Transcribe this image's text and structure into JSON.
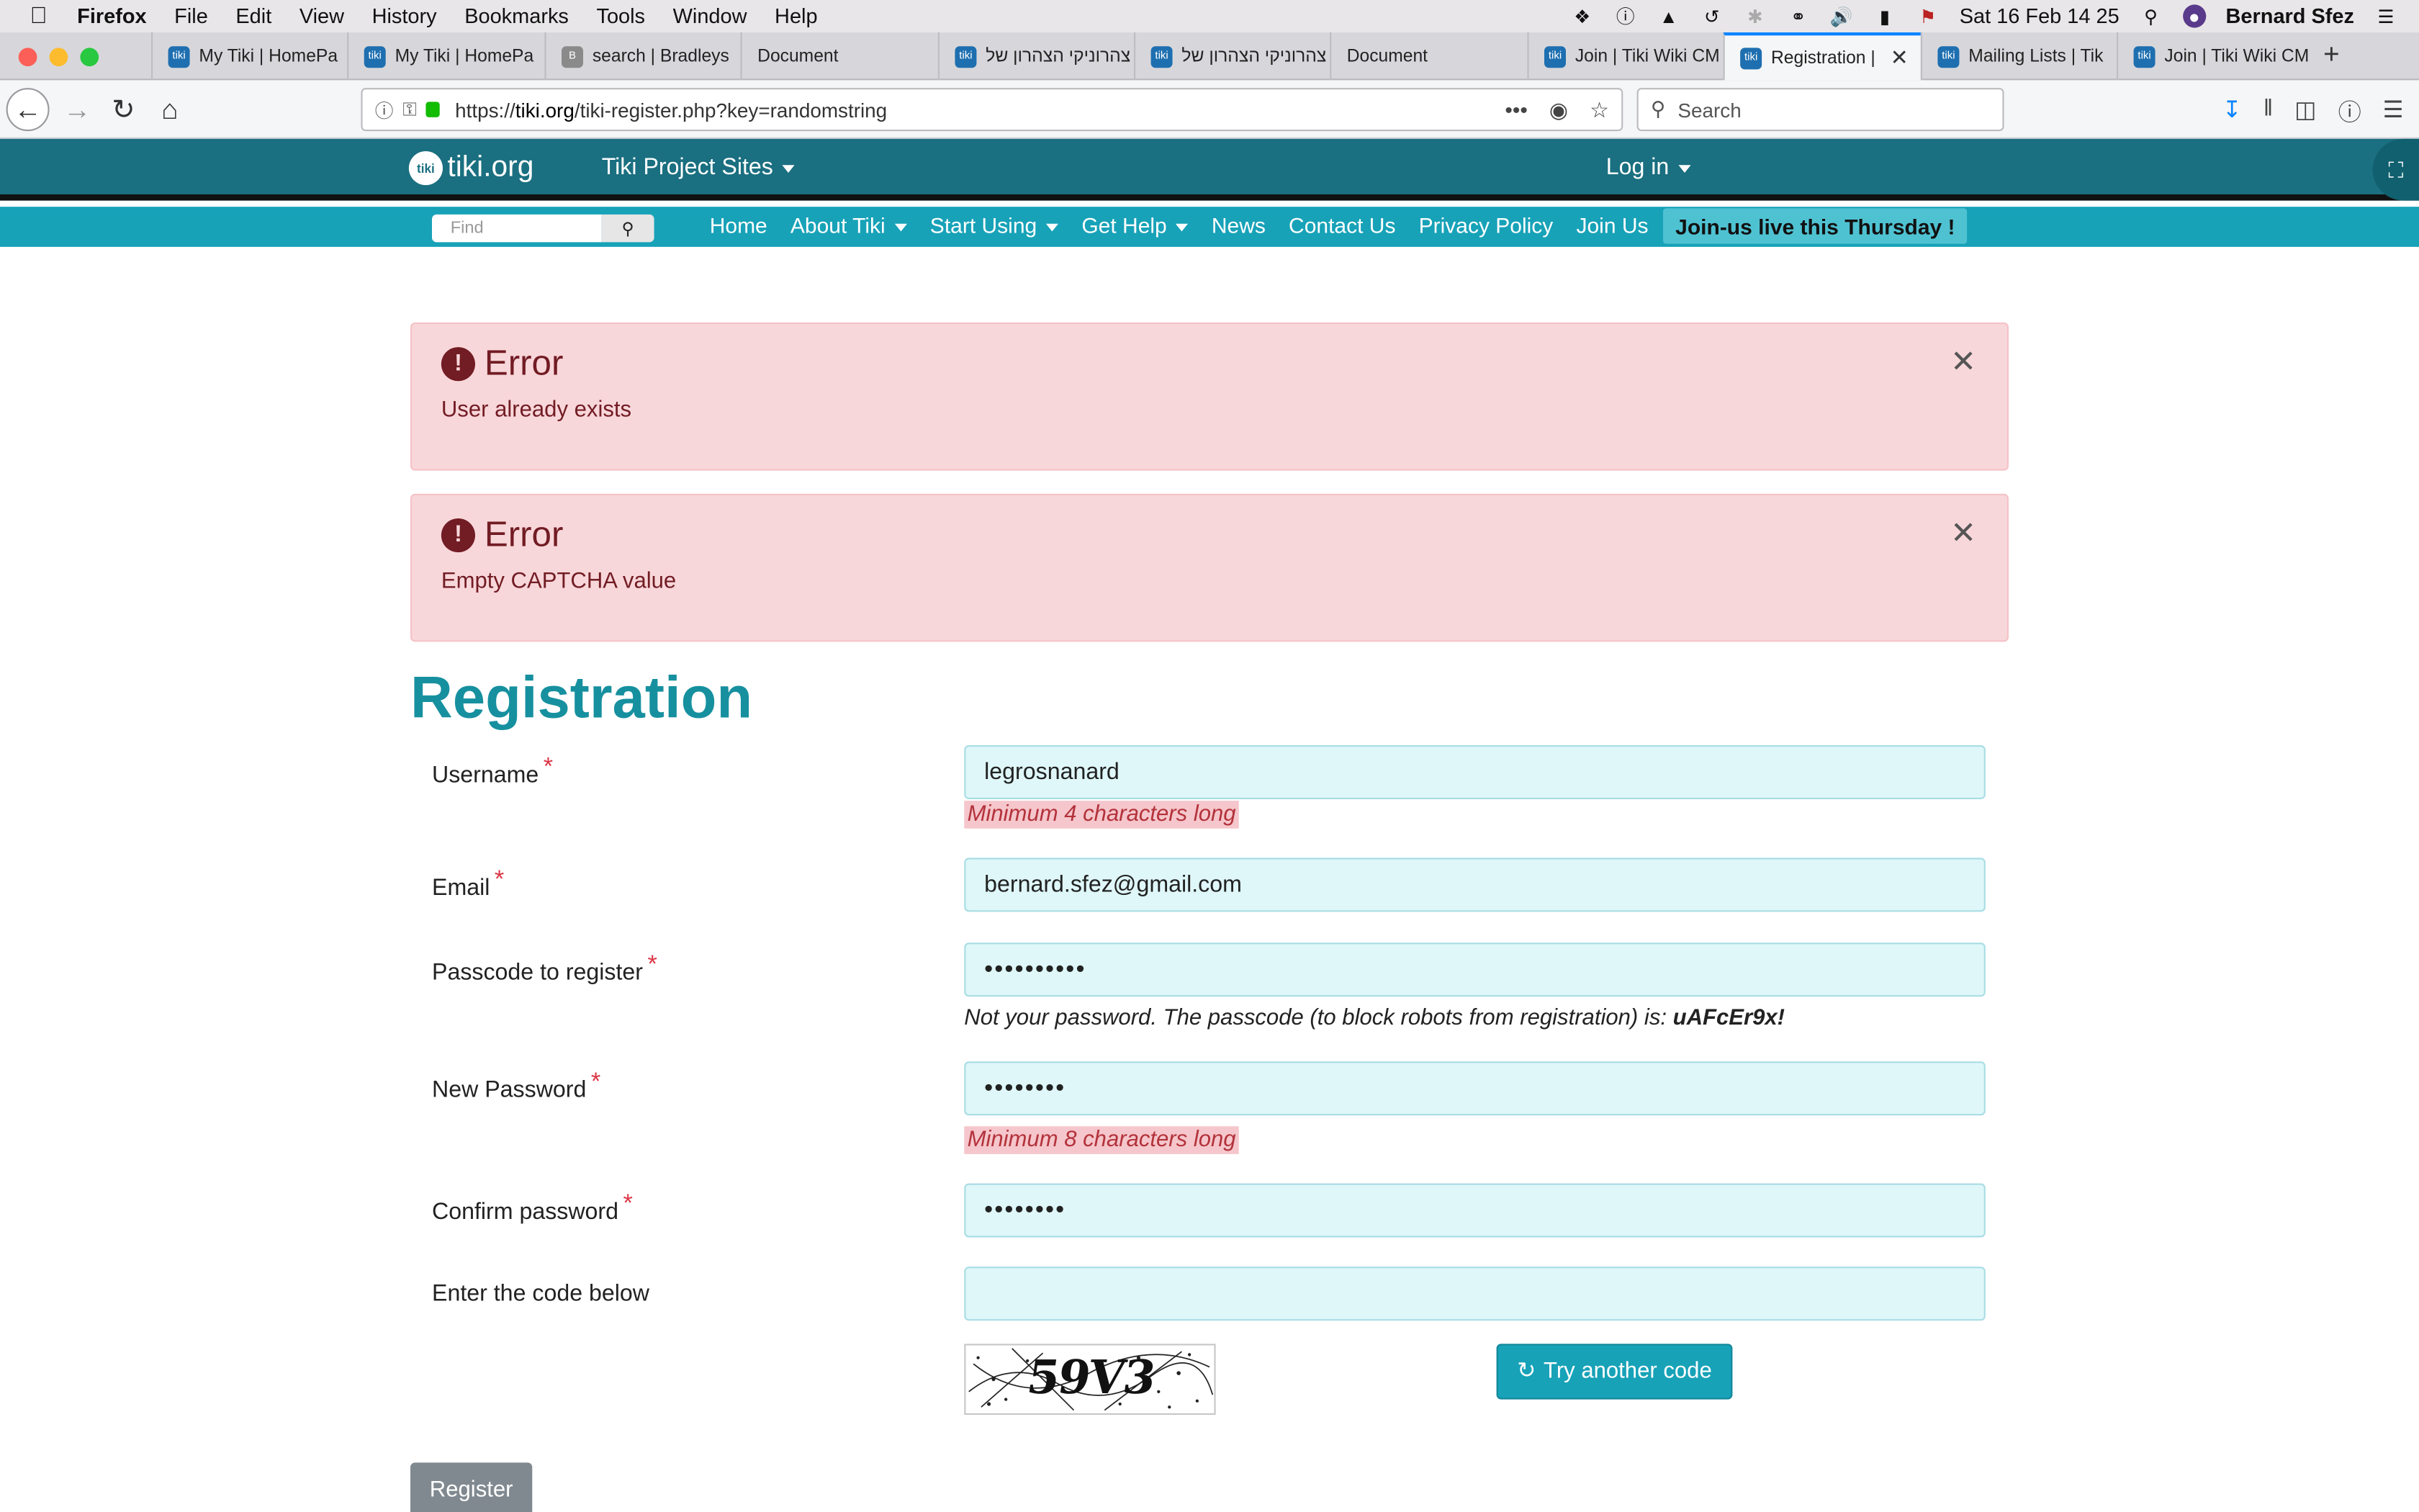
{
  "menubar": {
    "app": "Firefox",
    "items": [
      "File",
      "Edit",
      "View",
      "History",
      "Bookmarks",
      "Tools",
      "Window",
      "Help"
    ],
    "clock": "Sat 16 Feb  14 25",
    "user": "Bernard Sfez"
  },
  "tabs": [
    {
      "label": "My Tiki | HomePa",
      "icon": "tiki"
    },
    {
      "label": "My Tiki | HomePa",
      "icon": "tiki"
    },
    {
      "label": "search | Bradleys",
      "icon": "b"
    },
    {
      "label": "Document",
      "icon": "none"
    },
    {
      "label": "צהרוניקי הצהרון של",
      "icon": "tiki"
    },
    {
      "label": "צהרוניקי הצהרון של",
      "icon": "tiki"
    },
    {
      "label": "Document",
      "icon": "none"
    },
    {
      "label": "Join | Tiki Wiki CM",
      "icon": "tiki"
    },
    {
      "label": "Registration |",
      "icon": "tiki",
      "active": true
    },
    {
      "label": "Mailing Lists | Tik",
      "icon": "tiki"
    },
    {
      "label": "Join | Tiki Wiki CM",
      "icon": "tiki"
    }
  ],
  "browser": {
    "url_prefix": "https://",
    "url_domain": "tiki.org",
    "url_path": "/tiki-register.php?key=randomstring",
    "search_placeholder": "Search"
  },
  "site": {
    "logo": "tiki.org",
    "project_sites": "Tiki Project Sites",
    "login": "Log in",
    "find_placeholder": "Find",
    "nav": [
      "Home",
      "About Tiki",
      "Start Using",
      "Get Help",
      "News",
      "Contact Us",
      "Privacy Policy",
      "Join Us"
    ],
    "nav_dropdowns": [
      false,
      true,
      true,
      true,
      false,
      false,
      false,
      false
    ],
    "banner": "Join-us live this Thursday !"
  },
  "alerts": [
    {
      "title": "Error",
      "message": "User already exists"
    },
    {
      "title": "Error",
      "message": "Empty CAPTCHA value"
    }
  ],
  "form": {
    "title": "Registration",
    "username_label": "Username",
    "username_value": "legrosnanard",
    "username_hint": "Minimum 4 characters long",
    "email_label": "Email",
    "email_value": "bernard.sfez@gmail.com",
    "passcode_label": "Passcode to register",
    "passcode_value": "••••••••••",
    "passcode_note_text": "Not your password. The passcode (to block robots from registration) is: ",
    "passcode_note_code": "uAFcEr9x!",
    "newpass_label": "New Password",
    "newpass_value": "••••••••",
    "newpass_hint": "Minimum 8 characters long",
    "confirm_label": "Confirm password",
    "confirm_value": "••••••••",
    "captcha_label": "Enter the code below",
    "captcha_value": "",
    "captcha_text": "59V3",
    "try_another": "Try another code",
    "register": "Register"
  },
  "colors": {
    "brand_dark": "#1a6f80",
    "brand_light": "#17a2b8",
    "error_bg": "#f8d7da",
    "input_bg": "#dff7f9"
  }
}
